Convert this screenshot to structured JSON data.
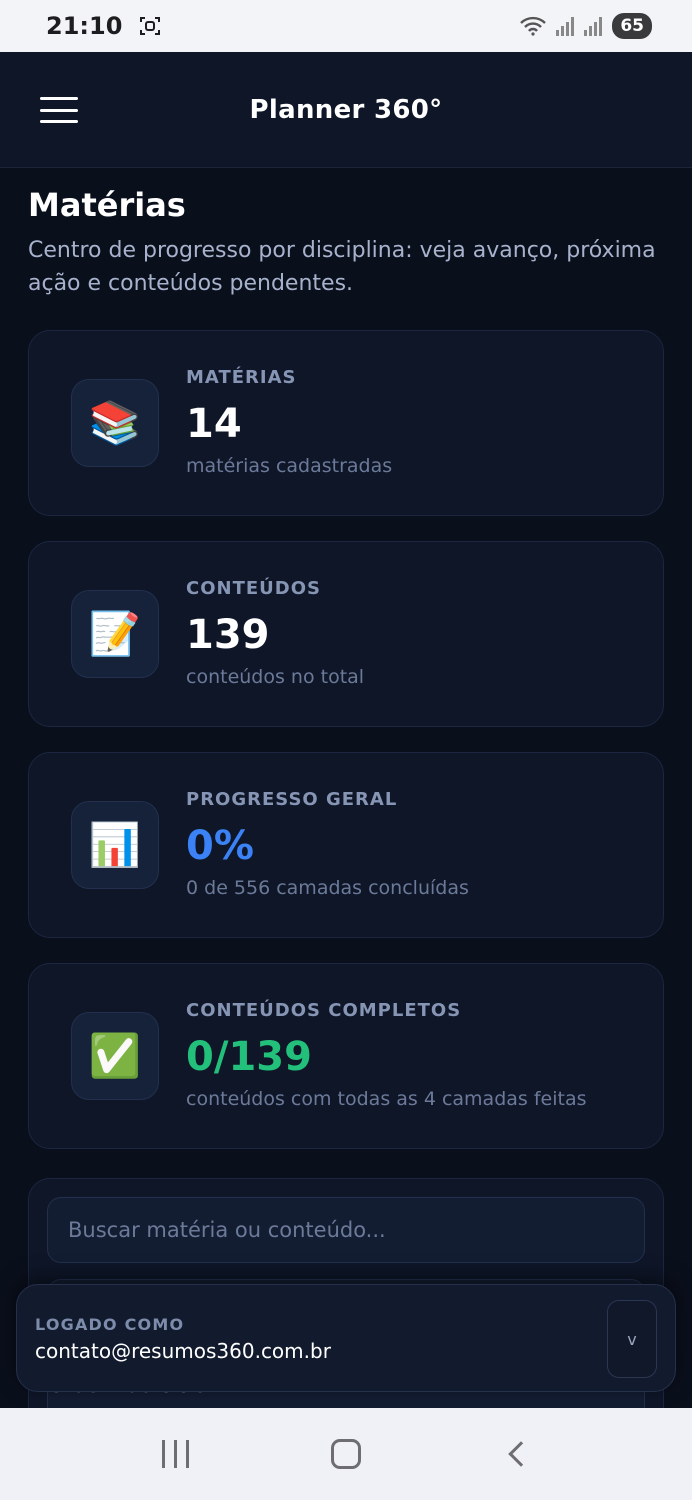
{
  "status": {
    "time": "21:10",
    "battery": "65",
    "icons": [
      "screenshot-icon",
      "wifi-icon",
      "signal-icon",
      "signal-icon",
      "battery-icon"
    ]
  },
  "appbar": {
    "title": "Planner 360°",
    "menu_icon": "menu-icon"
  },
  "page": {
    "title": "Matérias",
    "subtitle": "Centro de progresso por disciplina: veja avanço, próxima ação e conteúdos pendentes."
  },
  "stats": [
    {
      "icon": "📚",
      "label": "MATÉRIAS",
      "value": "14",
      "desc": "matérias cadastradas",
      "value_color": "#ffffff"
    },
    {
      "icon": "📝",
      "label": "CONTEÚDOS",
      "value": "139",
      "desc": "conteúdos no total",
      "value_color": "#ffffff"
    },
    {
      "icon": "📊",
      "label": "PROGRESSO GERAL",
      "value": "0%",
      "desc": "0 de 556 camadas concluídas",
      "value_color": "#3b82f6"
    },
    {
      "icon": "✅",
      "label": "CONTEÚDOS COMPLETOS",
      "value": "0/139",
      "desc": "conteúdos com todas as 4 camadas feitas",
      "value_color": "#22c07a"
    }
  ],
  "filters": {
    "search_placeholder": "Buscar matéria ou conteúdo...",
    "order_label": "Ordem do ciclo",
    "order_chevron": "v"
  },
  "user": {
    "label": "LOGADO COMO",
    "email": "contato@resumos360.com.br",
    "toggle": "v"
  },
  "colors": {
    "background": "#0a0f1c",
    "card": "#0e1628",
    "accent_blue": "#3b82f6",
    "accent_green": "#22c07a"
  }
}
